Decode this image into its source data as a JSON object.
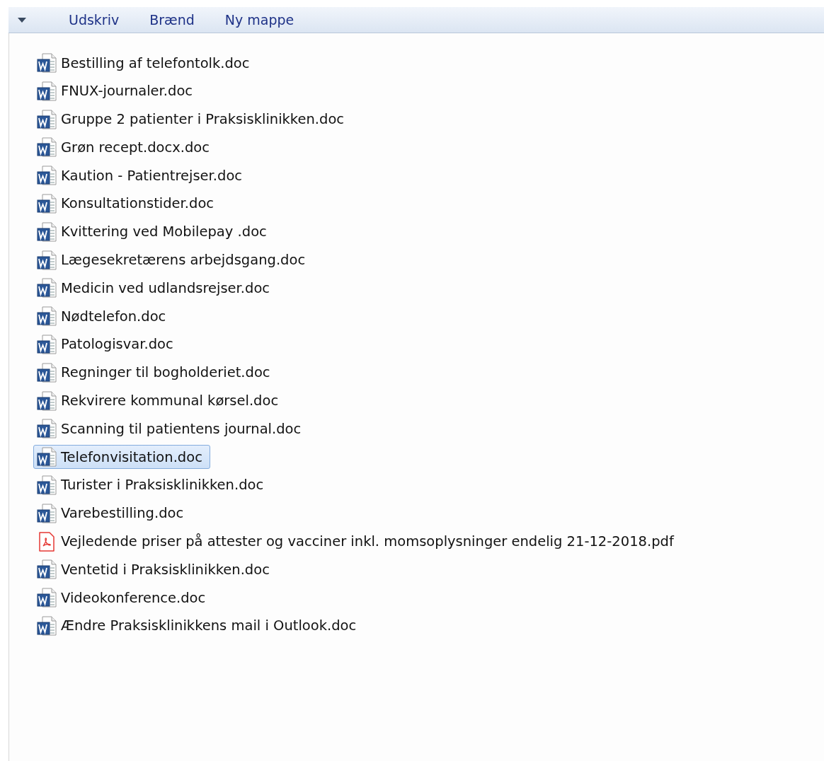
{
  "toolbar": {
    "buttons": [
      "Udskriv",
      "Brænd",
      "Ny mappe"
    ]
  },
  "files": [
    {
      "name": "Bestilling af telefontolk.doc",
      "kind": "word",
      "selected": false
    },
    {
      "name": "FNUX-journaler.doc",
      "kind": "word",
      "selected": false
    },
    {
      "name": "Gruppe 2 patienter i Praksisklinikken.doc",
      "kind": "word",
      "selected": false
    },
    {
      "name": "Grøn recept.docx.doc",
      "kind": "word",
      "selected": false
    },
    {
      "name": "Kaution - Patientrejser.doc",
      "kind": "word",
      "selected": false
    },
    {
      "name": "Konsultationstider.doc",
      "kind": "word",
      "selected": false
    },
    {
      "name": "Kvittering ved Mobilepay .doc",
      "kind": "word",
      "selected": false
    },
    {
      "name": "Lægesekretærens arbejdsgang.doc",
      "kind": "word",
      "selected": false
    },
    {
      "name": "Medicin ved udlandsrejser.doc",
      "kind": "word",
      "selected": false
    },
    {
      "name": "Nødtelefon.doc",
      "kind": "word",
      "selected": false
    },
    {
      "name": "Patologisvar.doc",
      "kind": "word",
      "selected": false
    },
    {
      "name": "Regninger til bogholderiet.doc",
      "kind": "word",
      "selected": false
    },
    {
      "name": "Rekvirere kommunal kørsel.doc",
      "kind": "word",
      "selected": false
    },
    {
      "name": "Scanning til patientens journal.doc",
      "kind": "word",
      "selected": false
    },
    {
      "name": "Telefonvisitation.doc",
      "kind": "word",
      "selected": true
    },
    {
      "name": "Turister i Praksisklinikken.doc",
      "kind": "word",
      "selected": false
    },
    {
      "name": "Varebestilling.doc",
      "kind": "word",
      "selected": false
    },
    {
      "name": "Vejledende priser på attester og vacciner inkl. momsoplysninger endelig 21-12-2018.pdf",
      "kind": "pdf",
      "selected": false
    },
    {
      "name": "Ventetid i Praksisklinikken.doc",
      "kind": "word",
      "selected": false
    },
    {
      "name": "Videokonference.doc",
      "kind": "word",
      "selected": false
    },
    {
      "name": "Ændre Praksisklinikkens mail i Outlook.doc",
      "kind": "word",
      "selected": false
    }
  ]
}
